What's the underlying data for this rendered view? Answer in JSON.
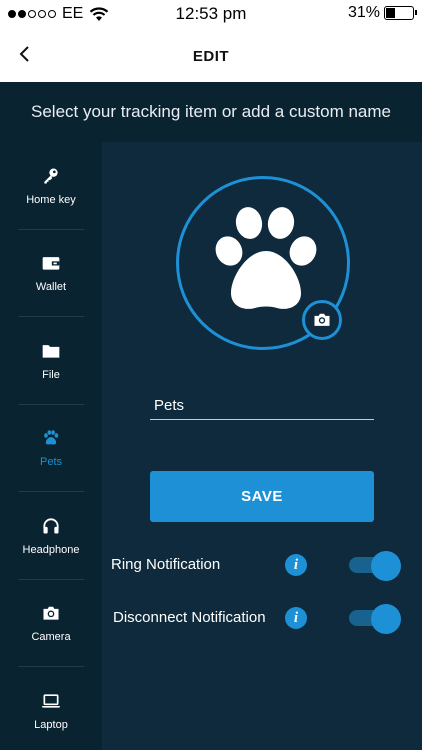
{
  "status_bar": {
    "carrier": "EE",
    "signal_dots_filled": 2,
    "signal_dots_total": 5,
    "time": "12:53 pm",
    "battery_percent": "31%"
  },
  "nav": {
    "title": "EDIT",
    "back_icon": "chevron-left-icon"
  },
  "subtitle": "Select your tracking item or add a custom name",
  "sidebar": {
    "items": [
      {
        "label": "Home key",
        "icon": "key-icon",
        "active": false
      },
      {
        "label": "Wallet",
        "icon": "wallet-icon",
        "active": false
      },
      {
        "label": "File",
        "icon": "folder-icon",
        "active": false
      },
      {
        "label": "Pets",
        "icon": "paw-icon",
        "active": true
      },
      {
        "label": "Headphone",
        "icon": "headphone-icon",
        "active": false
      },
      {
        "label": "Camera",
        "icon": "camera-icon",
        "active": false
      },
      {
        "label": "Laptop",
        "icon": "laptop-icon",
        "active": false
      }
    ]
  },
  "editor": {
    "avatar_icon": "paw-icon",
    "change_photo_icon": "camera-icon",
    "name_value": "Pets",
    "save_label": "SAVE"
  },
  "settings": [
    {
      "label": "Ring Notification",
      "enabled": true
    },
    {
      "label": "Disconnect Notification",
      "enabled": true
    }
  ],
  "colors": {
    "accent": "#1e90d6",
    "background": "#0e2a3c",
    "sidebar_background": "#0a2331"
  }
}
